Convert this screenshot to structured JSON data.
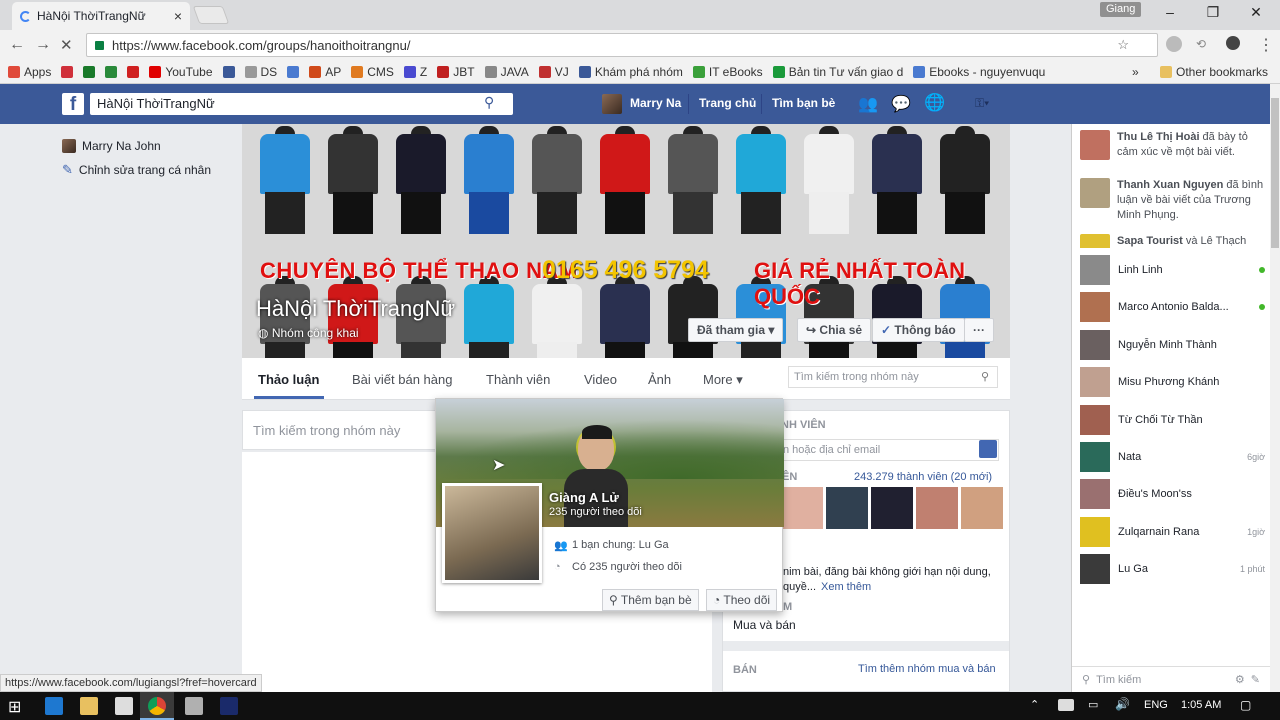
{
  "browser": {
    "tab_title": "HàNội ThờiTrangNữ",
    "profile": "Giang",
    "url": "https://www.facebook.com/groups/hanoithoitrangnu/"
  },
  "bookmarks": [
    {
      "label": "Apps",
      "color": "#e04a3a"
    },
    {
      "label": "",
      "color": "#d0303a"
    },
    {
      "label": "",
      "color": "#1a7a2a"
    },
    {
      "label": "",
      "color": "#2a8a3a"
    },
    {
      "label": "",
      "color": "#d02020"
    },
    {
      "label": "YouTube",
      "color": "#e00000"
    },
    {
      "label": "",
      "color": "#3b5998"
    },
    {
      "label": "DS",
      "color": "#999999"
    },
    {
      "label": "",
      "color": "#4a7ad0"
    },
    {
      "label": "AP",
      "color": "#d04a1a"
    },
    {
      "label": "CMS",
      "color": "#e07a20"
    },
    {
      "label": "Z",
      "color": "#4a4ad0"
    },
    {
      "label": "JBT",
      "color": "#c02020"
    },
    {
      "label": "JAVA",
      "color": "#888888"
    },
    {
      "label": "VJ",
      "color": "#c03030"
    },
    {
      "label": "Khám phá nhóm",
      "color": "#3b5998"
    },
    {
      "label": "IT eBooks",
      "color": "#3aa03a"
    },
    {
      "label": "Bản tin Tư vấn giao d",
      "color": "#1a9a3a"
    },
    {
      "label": "Ebooks - nguyenvuqu",
      "color": "#4a7ad0"
    }
  ],
  "other_bookmarks": "Other bookmarks",
  "fb": {
    "search_value": "HàNội ThờiTrangNữ",
    "user": "Marry Na",
    "home": "Trang chủ",
    "find_friends": "Tìm bạn bè"
  },
  "left": {
    "profile": "Marry Na John",
    "edit": "Chỉnh sửa trang cá nhân"
  },
  "cover": {
    "banner1": "CHUYÊN BỘ THỂ THAO NAM",
    "banner2": "0165 496 5794",
    "banner3": "GIÁ RẺ NHẤT TOÀN QUỐC",
    "title": "HàNội ThờiTrangNữ",
    "type": "Nhóm công khai",
    "joined": "Đã tham gia",
    "share": "Chia sẻ",
    "notify": "Thông báo",
    "more": "···"
  },
  "group_tabs": {
    "items": [
      "Thảo luận",
      "Bài viết bán hàng",
      "Thành viên",
      "Video",
      "Ảnh",
      "More"
    ],
    "search_placeholder": "Tìm kiếm trong nhóm này"
  },
  "composer": {
    "placeholder": "Tìm kiếm trong nhóm này"
  },
  "right": {
    "members_head": "NH VIÊN",
    "add_placeholder": "n hoặc địa chỉ email",
    "members_label": "IÊN",
    "members_count": "243.279 thành viên (20 mới)",
    "desc": "nim bài, đăng bài không giới hạn nội dung,",
    "desc2": "quyề...",
    "see_more": "Xem thêm",
    "section_tail": "M",
    "buysell": "Mua và bán",
    "ban": "BÁN",
    "find_more": "Tìm thêm nhóm mua và bán"
  },
  "hovercard": {
    "name": "Giàng A Lử",
    "followers": "235 người theo dõi",
    "mutual": "1 bạn chung: Lu Ga",
    "following": "Có 235 người theo dõi",
    "add_friend": "Thêm bạn bè",
    "follow": "Theo dõi"
  },
  "ticker": [
    {
      "name": "Thu Lê Thị Hoài",
      "text": " đã bày tỏ cảm xúc về một bài viết."
    },
    {
      "name": "Thanh Xuan Nguyen",
      "text": " đã bình luận về bài viết của Trương Minh Phụng."
    },
    {
      "name": "Sapa Tourist",
      "text": " và Lê Thạch"
    }
  ],
  "chat": [
    {
      "name": "Linh Linh",
      "status": "online"
    },
    {
      "name": "Marco Antonio Balda...",
      "status": "online"
    },
    {
      "name": "Nguyễn Minh Thành",
      "status": ""
    },
    {
      "name": "Misu Phương Khánh",
      "status": ""
    },
    {
      "name": "Từ Chối Từ Thần",
      "status": ""
    },
    {
      "name": "Nata",
      "status": "6giờ"
    },
    {
      "name": "Điều's Moon'ss",
      "status": ""
    },
    {
      "name": "Zulqarnain Rana",
      "status": "1giờ"
    },
    {
      "name": "Lu Ga",
      "status": "1 phút"
    }
  ],
  "chat_search": "Tìm kiếm",
  "statusbar": "https://www.facebook.com/lugiangsl?fref=hovercard",
  "taskbar": {
    "lang": "ENG",
    "time": "1:05 AM"
  }
}
